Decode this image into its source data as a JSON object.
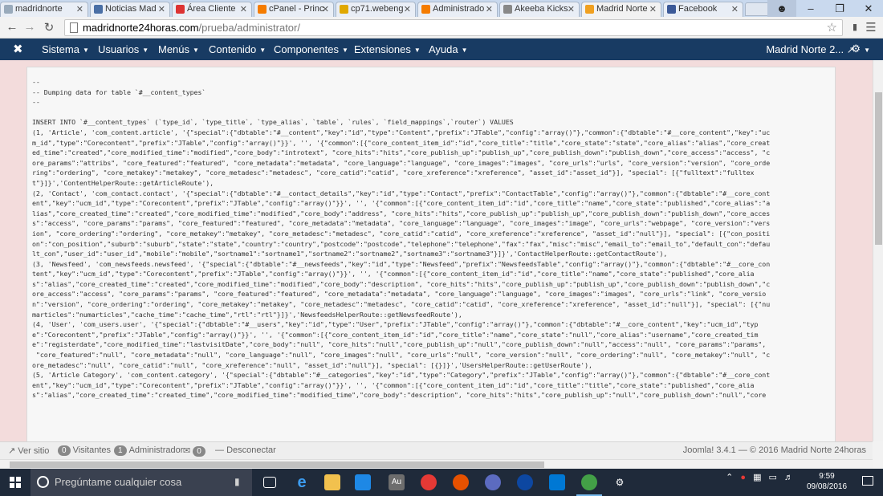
{
  "browser": {
    "tabs": [
      {
        "title": "madridnorte",
        "color": "#9ab"
      },
      {
        "title": "Noticias Mad",
        "color": "#4a6fa5"
      },
      {
        "title": "Área Cliente",
        "color": "#d33"
      },
      {
        "title": "cPanel - Princ",
        "color": "#f57c00"
      },
      {
        "title": "cp71.webeng",
        "color": "#e0a800"
      },
      {
        "title": "Administrado",
        "color": "#f57c00"
      },
      {
        "title": "Akeeba Kicks",
        "color": "#888"
      },
      {
        "title": "Madrid Norte",
        "color": "#f0a020"
      },
      {
        "title": "Facebook",
        "color": "#3b5998"
      }
    ],
    "url_host": "madridnorte24horas.com",
    "url_path": "/prueba/administrator/"
  },
  "joomla_nav": {
    "menu": [
      "Sistema",
      "Usuarios",
      "Menús",
      "Contenido",
      "Componentes",
      "Extensiones",
      "Ayuda"
    ],
    "site_link": "Madrid Norte 2...",
    "accent": "#183b63"
  },
  "code": {
    "lines": [
      "--",
      "-- Dumping data for table `#__content_types`",
      "--",
      "",
      "INSERT INTO `#__content_types` (`type_id`, `type_title`, `type_alias`, `table`, `rules`, `field_mappings`,`router`) VALUES",
      "(1, 'Article', 'com_content.article', '{\"special\":{\"dbtable\":\"#__content\",\"key\":\"id\",\"type\":\"Content\",\"prefix\":\"JTable\",\"config\":\"array()\"},\"common\":{\"dbtable\":\"#__core_content\",\"key\":\"uc",
      "m_id\",\"type\":\"Corecontent\",\"prefix\":\"JTable\",\"config\":\"array()\"}}', '', '{\"common\":[{\"core_content_item_id\":\"id\",\"core_title\":\"title\",\"core_state\":\"state\",\"core_alias\":\"alias\",\"core_creat",
      "ed_time\":\"created\",\"core_modified_time\":\"modified\",\"core_body\":\"introtext\", \"core_hits\":\"hits\",\"core_publish_up\":\"publish_up\",\"core_publish_down\":\"publish_down\",\"core_access\":\"access\", \"c",
      "ore_params\":\"attribs\", \"core_featured\":\"featured\", \"core_metadata\":\"metadata\", \"core_language\":\"language\", \"core_images\":\"images\", \"core_urls\":\"urls\", \"core_version\":\"version\", \"core_orde",
      "ring\":\"ordering\", \"core_metakey\":\"metakey\", \"core_metadesc\":\"metadesc\", \"core_catid\":\"catid\", \"core_xreference\":\"xreference\", \"asset_id\":\"asset_id\"}], \"special\": [{\"fulltext\":\"fulltex",
      "t\"}]}','ContentHelperRoute::getArticleRoute'),",
      "(2, 'Contact', 'com_contact.contact', '{\"special\":{\"dbtable\":\"#__contact_details\",\"key\":\"id\",\"type\":\"Contact\",\"prefix\":\"ContactTable\",\"config\":\"array()\"},\"common\":{\"dbtable\":\"#__core_cont",
      "ent\",\"key\":\"ucm_id\",\"type\":\"Corecontent\",\"prefix\":\"JTable\",\"config\":\"array()\"}}', '', '{\"common\":[{\"core_content_item_id\":\"id\",\"core_title\":\"name\",\"core_state\":\"published\",\"core_alias\":\"a",
      "lias\",\"core_created_time\":\"created\",\"core_modified_time\":\"modified\",\"core_body\":\"address\", \"core_hits\":\"hits\",\"core_publish_up\":\"publish_up\",\"core_publish_down\":\"publish_down\",\"core_acces",
      "s\":\"access\", \"core_params\":\"params\", \"core_featured\":\"featured\", \"core_metadata\":\"metadata\", \"core_language\":\"language\", \"core_images\":\"image\", \"core_urls\":\"webpage\", \"core_version\":\"vers",
      "ion\", \"core_ordering\":\"ordering\", \"core_metakey\":\"metakey\", \"core_metadesc\":\"metadesc\", \"core_catid\":\"catid\", \"core_xreference\":\"xreference\", \"asset_id\":\"null\"}], \"special\": [{\"con_positi",
      "on\":\"con_position\",\"suburb\":\"suburb\",\"state\":\"state\",\"country\":\"country\",\"postcode\":\"postcode\",\"telephone\":\"telephone\",\"fax\":\"fax\",\"misc\":\"misc\",\"email_to\":\"email_to\",\"default_con\":\"defau",
      "lt_con\",\"user_id\":\"user_id\",\"mobile\":\"mobile\",\"sortname1\":\"sortname1\",\"sortname2\":\"sortname2\",\"sortname3\":\"sortname3\"}]}','ContactHelperRoute::getContactRoute'),",
      "(3, 'Newsfeed', 'com_newsfeeds.newsfeed', '{\"special\":{\"dbtable\":\"#__newsfeeds\",\"key\":\"id\",\"type\":\"Newsfeed\",\"prefix\":\"NewsfeedsTable\",\"config\":\"array()\"},\"common\":{\"dbtable\":\"#__core_con",
      "tent\",\"key\":\"ucm_id\",\"type\":\"Corecontent\",\"prefix\":\"JTable\",\"config\":\"array()\"}}', '', '{\"common\":[{\"core_content_item_id\":\"id\",\"core_title\":\"name\",\"core_state\":\"published\",\"core_alia",
      "s\":\"alias\",\"core_created_time\":\"created\",\"core_modified_time\":\"modified\",\"core_body\":\"description\", \"core_hits\":\"hits\",\"core_publish_up\":\"publish_up\",\"core_publish_down\":\"publish_down\",\"c",
      "ore_access\":\"access\", \"core_params\":\"params\", \"core_featured\":\"featured\", \"core_metadata\":\"metadata\", \"core_language\":\"language\", \"core_images\":\"images\", \"core_urls\":\"link\", \"core_versio",
      "n\":\"version\", \"core_ordering\":\"ordering\", \"core_metakey\":\"metakey\", \"core_metadesc\":\"metadesc\", \"core_catid\":\"catid\", \"core_xreference\":\"xreference\", \"asset_id\":\"null\"}], \"special\": [{\"nu",
      "marticles\":\"numarticles\",\"cache_time\":\"cache_time\",\"rtl\":\"rtl\"}]}','NewsfeedsHelperRoute::getNewsfeedRoute'),",
      "(4, 'User', 'com_users.user', '{\"special\":{\"dbtable\":\"#__users\",\"key\":\"id\",\"type\":\"User\",\"prefix\":\"JTable\",\"config\":\"array()\"},\"common\":{\"dbtable\":\"#__core_content\",\"key\":\"ucm_id\",\"typ",
      "e\":\"Corecontent\",\"prefix\":\"JTable\",\"config\":\"array()\"}}', '', '{\"common\":[{\"core_content_item_id\":\"id\",\"core_title\":\"name\",\"core_state\":\"null\",\"core_alias\":\"username\",\"core_created_tim",
      "e\":\"registerdate\",\"core_modified_time\":\"lastvisitDate\",\"core_body\":\"null\", \"core_hits\":\"null\",\"core_publish_up\":\"null\",\"core_publish_down\":\"null\",\"access\":\"null\", \"core_params\":\"params\",",
      " \"core_featured\":\"null\", \"core_metadata\":\"null\", \"core_language\":\"null\", \"core_images\":\"null\", \"core_urls\":\"null\", \"core_version\":\"null\", \"core_ordering\":\"null\", \"core_metakey\":\"null\", \"c",
      "ore_metadesc\":\"null\", \"core_catid\":\"null\", \"core_xreference\":\"null\", \"asset_id\":\"null\"}], \"special\": [{}]}','UsersHelperRoute::getUserRoute'),",
      "(5, 'Article Category', 'com_content.category', '{\"special\":{\"dbtable\":\"#__categories\",\"key\":\"id\",\"type\":\"Category\",\"prefix\":\"JTable\",\"config\":\"array()\"},\"common\":{\"dbtable\":\"#__core_cont",
      "ent\",\"key\":\"ucm_id\",\"type\":\"Corecontent\",\"prefix\":\"JTable\",\"config\":\"array()\"}}', '', '{\"common\":[{\"core_content_item_id\":\"id\",\"core_title\":\"title\",\"core_state\":\"published\",\"core_alia",
      "s\":\"alias\",\"core_created_time\":\"created_time\",\"core_modified_time\":\"modified_time\",\"core_body\":\"description\", \"core_hits\":\"hits\",\"core_publish_up\":\"null\",\"core_publish_down\":\"null\",\"core"
    ]
  },
  "statusbar": {
    "view_site": "Ver sitio",
    "visitors_count": "0",
    "visitors_label": "Visitantes",
    "admins_count": "1",
    "admins_label": "Administrador",
    "messages_count": "0",
    "logout": "Desconectar",
    "footer": "Joomla! 3.4.1 — © 2016 Madrid Norte 24horas"
  },
  "taskbar": {
    "search_placeholder": "Pregúntame cualquier cosa",
    "time": "9:59",
    "date": "09/08/2016"
  }
}
